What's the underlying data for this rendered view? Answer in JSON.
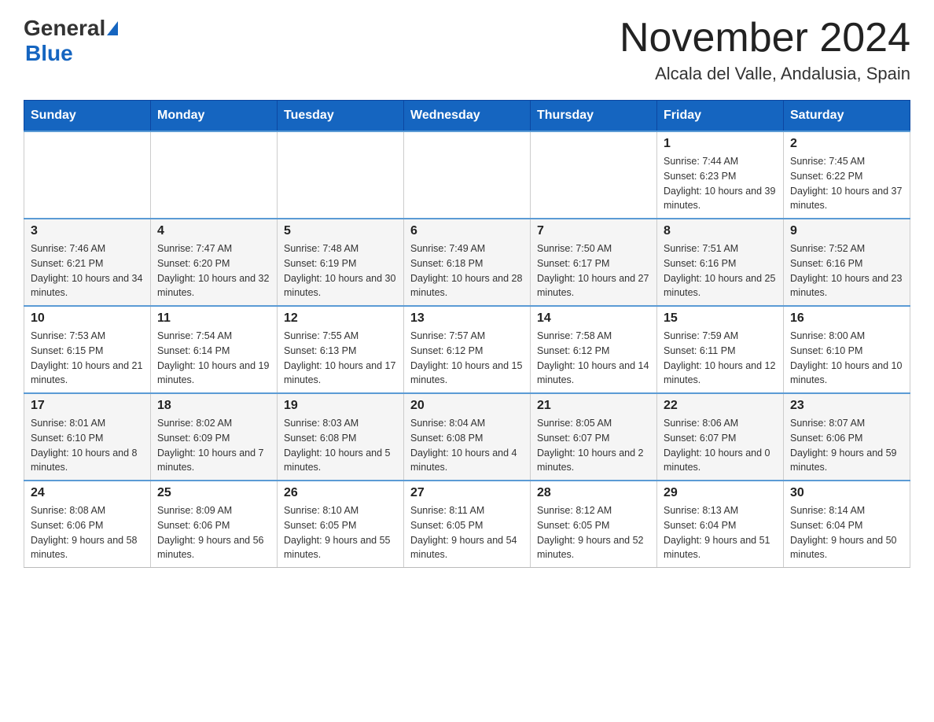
{
  "header": {
    "logo": {
      "general": "General",
      "blue": "Blue"
    },
    "title": "November 2024",
    "location": "Alcala del Valle, Andalusia, Spain"
  },
  "weekdays": [
    "Sunday",
    "Monday",
    "Tuesday",
    "Wednesday",
    "Thursday",
    "Friday",
    "Saturday"
  ],
  "weeks": [
    {
      "days": [
        {
          "number": "",
          "info": ""
        },
        {
          "number": "",
          "info": ""
        },
        {
          "number": "",
          "info": ""
        },
        {
          "number": "",
          "info": ""
        },
        {
          "number": "",
          "info": ""
        },
        {
          "number": "1",
          "info": "Sunrise: 7:44 AM\nSunset: 6:23 PM\nDaylight: 10 hours and 39 minutes."
        },
        {
          "number": "2",
          "info": "Sunrise: 7:45 AM\nSunset: 6:22 PM\nDaylight: 10 hours and 37 minutes."
        }
      ]
    },
    {
      "days": [
        {
          "number": "3",
          "info": "Sunrise: 7:46 AM\nSunset: 6:21 PM\nDaylight: 10 hours and 34 minutes."
        },
        {
          "number": "4",
          "info": "Sunrise: 7:47 AM\nSunset: 6:20 PM\nDaylight: 10 hours and 32 minutes."
        },
        {
          "number": "5",
          "info": "Sunrise: 7:48 AM\nSunset: 6:19 PM\nDaylight: 10 hours and 30 minutes."
        },
        {
          "number": "6",
          "info": "Sunrise: 7:49 AM\nSunset: 6:18 PM\nDaylight: 10 hours and 28 minutes."
        },
        {
          "number": "7",
          "info": "Sunrise: 7:50 AM\nSunset: 6:17 PM\nDaylight: 10 hours and 27 minutes."
        },
        {
          "number": "8",
          "info": "Sunrise: 7:51 AM\nSunset: 6:16 PM\nDaylight: 10 hours and 25 minutes."
        },
        {
          "number": "9",
          "info": "Sunrise: 7:52 AM\nSunset: 6:16 PM\nDaylight: 10 hours and 23 minutes."
        }
      ]
    },
    {
      "days": [
        {
          "number": "10",
          "info": "Sunrise: 7:53 AM\nSunset: 6:15 PM\nDaylight: 10 hours and 21 minutes."
        },
        {
          "number": "11",
          "info": "Sunrise: 7:54 AM\nSunset: 6:14 PM\nDaylight: 10 hours and 19 minutes."
        },
        {
          "number": "12",
          "info": "Sunrise: 7:55 AM\nSunset: 6:13 PM\nDaylight: 10 hours and 17 minutes."
        },
        {
          "number": "13",
          "info": "Sunrise: 7:57 AM\nSunset: 6:12 PM\nDaylight: 10 hours and 15 minutes."
        },
        {
          "number": "14",
          "info": "Sunrise: 7:58 AM\nSunset: 6:12 PM\nDaylight: 10 hours and 14 minutes."
        },
        {
          "number": "15",
          "info": "Sunrise: 7:59 AM\nSunset: 6:11 PM\nDaylight: 10 hours and 12 minutes."
        },
        {
          "number": "16",
          "info": "Sunrise: 8:00 AM\nSunset: 6:10 PM\nDaylight: 10 hours and 10 minutes."
        }
      ]
    },
    {
      "days": [
        {
          "number": "17",
          "info": "Sunrise: 8:01 AM\nSunset: 6:10 PM\nDaylight: 10 hours and 8 minutes."
        },
        {
          "number": "18",
          "info": "Sunrise: 8:02 AM\nSunset: 6:09 PM\nDaylight: 10 hours and 7 minutes."
        },
        {
          "number": "19",
          "info": "Sunrise: 8:03 AM\nSunset: 6:08 PM\nDaylight: 10 hours and 5 minutes."
        },
        {
          "number": "20",
          "info": "Sunrise: 8:04 AM\nSunset: 6:08 PM\nDaylight: 10 hours and 4 minutes."
        },
        {
          "number": "21",
          "info": "Sunrise: 8:05 AM\nSunset: 6:07 PM\nDaylight: 10 hours and 2 minutes."
        },
        {
          "number": "22",
          "info": "Sunrise: 8:06 AM\nSunset: 6:07 PM\nDaylight: 10 hours and 0 minutes."
        },
        {
          "number": "23",
          "info": "Sunrise: 8:07 AM\nSunset: 6:06 PM\nDaylight: 9 hours and 59 minutes."
        }
      ]
    },
    {
      "days": [
        {
          "number": "24",
          "info": "Sunrise: 8:08 AM\nSunset: 6:06 PM\nDaylight: 9 hours and 58 minutes."
        },
        {
          "number": "25",
          "info": "Sunrise: 8:09 AM\nSunset: 6:06 PM\nDaylight: 9 hours and 56 minutes."
        },
        {
          "number": "26",
          "info": "Sunrise: 8:10 AM\nSunset: 6:05 PM\nDaylight: 9 hours and 55 minutes."
        },
        {
          "number": "27",
          "info": "Sunrise: 8:11 AM\nSunset: 6:05 PM\nDaylight: 9 hours and 54 minutes."
        },
        {
          "number": "28",
          "info": "Sunrise: 8:12 AM\nSunset: 6:05 PM\nDaylight: 9 hours and 52 minutes."
        },
        {
          "number": "29",
          "info": "Sunrise: 8:13 AM\nSunset: 6:04 PM\nDaylight: 9 hours and 51 minutes."
        },
        {
          "number": "30",
          "info": "Sunrise: 8:14 AM\nSunset: 6:04 PM\nDaylight: 9 hours and 50 minutes."
        }
      ]
    }
  ]
}
